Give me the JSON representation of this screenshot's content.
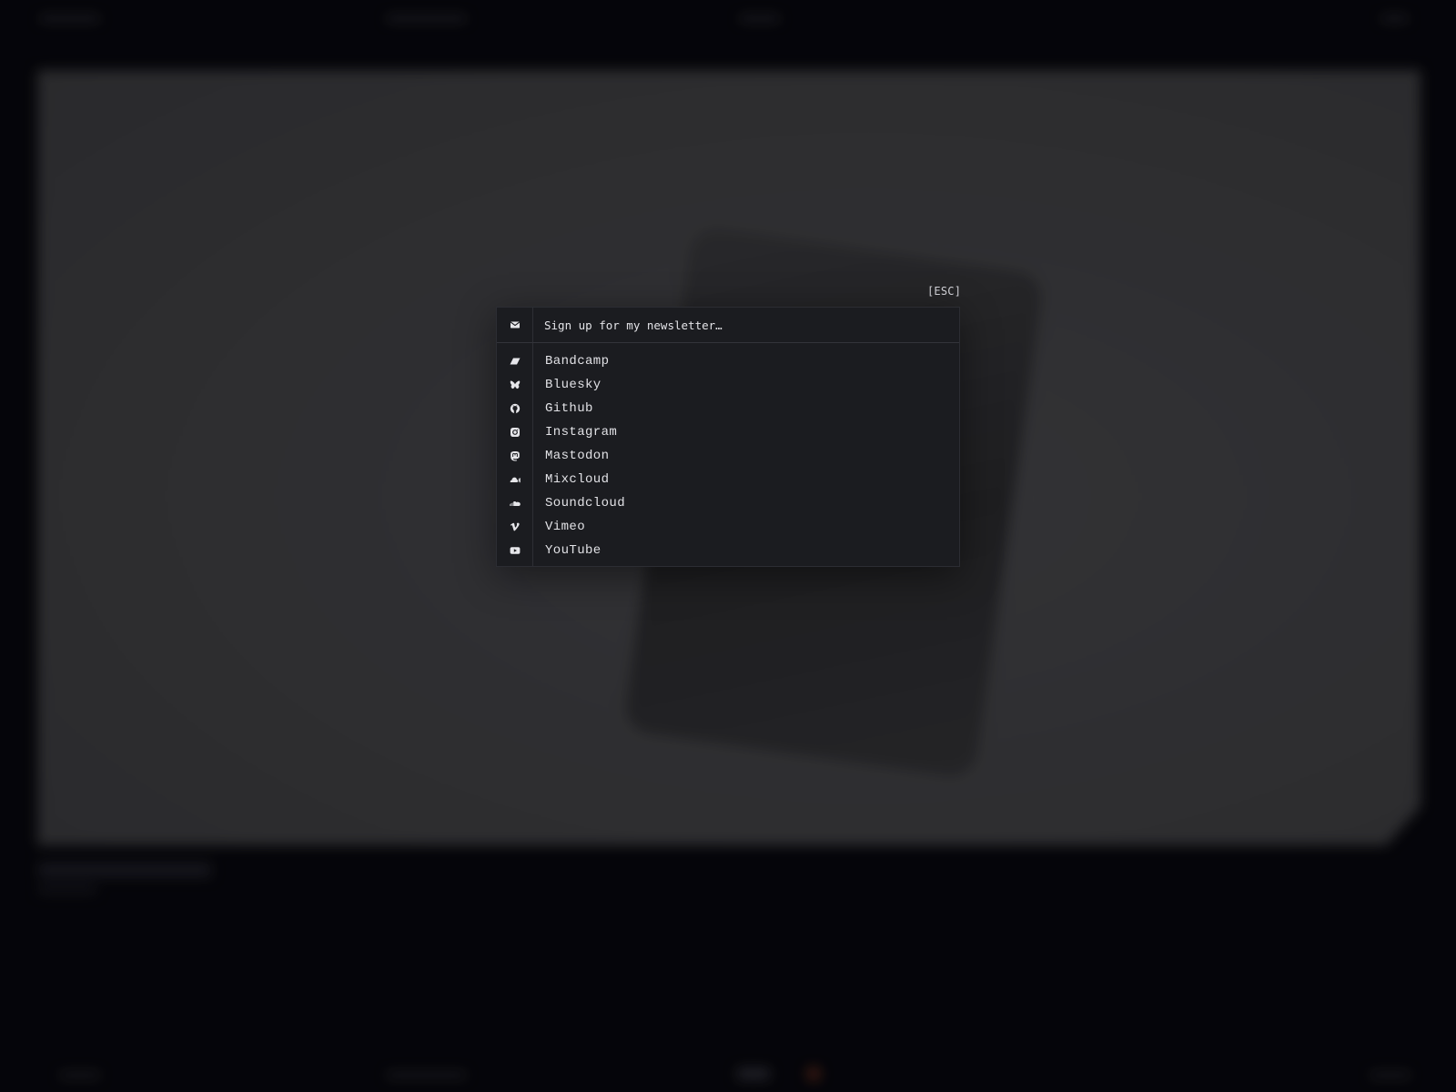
{
  "modal": {
    "esc_label": "[ESC]",
    "newsletter": {
      "icon": "mail-icon",
      "placeholder": "Sign up for my newsletter…"
    },
    "links": [
      {
        "label": "Bandcamp",
        "icon": "bandcamp-icon"
      },
      {
        "label": "Bluesky",
        "icon": "bluesky-icon"
      },
      {
        "label": "Github",
        "icon": "github-icon"
      },
      {
        "label": "Instagram",
        "icon": "instagram-icon"
      },
      {
        "label": "Mastodon",
        "icon": "mastodon-icon"
      },
      {
        "label": "Mixcloud",
        "icon": "mixcloud-icon"
      },
      {
        "label": "Soundcloud",
        "icon": "soundcloud-icon"
      },
      {
        "label": "Vimeo",
        "icon": "vimeo-icon"
      },
      {
        "label": "YouTube",
        "icon": "youtube-icon"
      }
    ]
  },
  "colors": {
    "backdrop": "#06060b",
    "modal_bg": "#1b1c20",
    "text": "#e2e2e6"
  }
}
